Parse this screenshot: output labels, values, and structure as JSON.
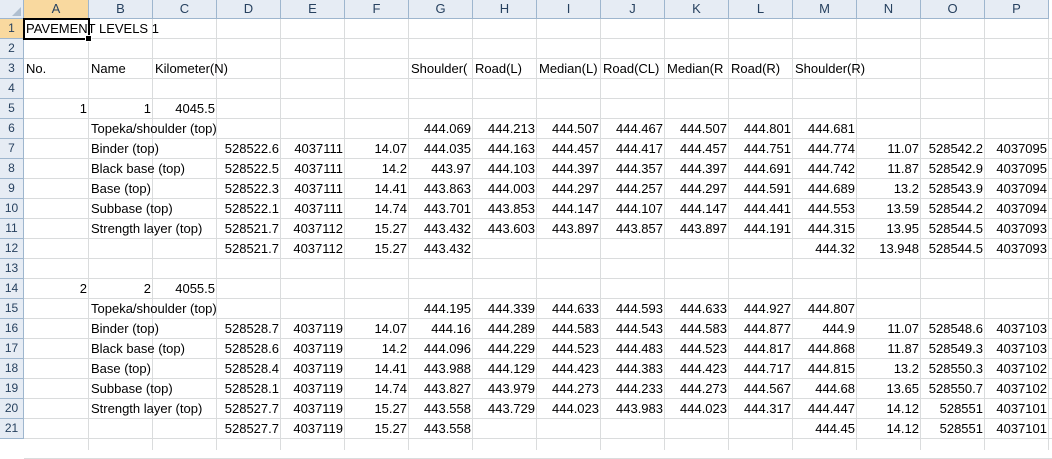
{
  "columns": [
    "A",
    "B",
    "C",
    "D",
    "E",
    "F",
    "G",
    "H",
    "I",
    "J",
    "K",
    "L",
    "M",
    "N",
    "O",
    "P"
  ],
  "rows": [
    "1",
    "2",
    "3",
    "4",
    "5",
    "6",
    "7",
    "8",
    "9",
    "10",
    "11",
    "12",
    "13",
    "14",
    "15",
    "16",
    "17",
    "18",
    "19",
    "20",
    "21"
  ],
  "active_cell": "A1",
  "cells": [
    {
      "r": 0,
      "c": 0,
      "v": "PAVEMENT LEVELS 1",
      "t": "s"
    },
    {
      "r": 2,
      "c": 0,
      "v": "No.",
      "t": "s"
    },
    {
      "r": 2,
      "c": 1,
      "v": "Name",
      "t": "s"
    },
    {
      "r": 2,
      "c": 2,
      "v": "Kilometer(N)",
      "t": "s"
    },
    {
      "r": 2,
      "c": 6,
      "v": "Shoulder(",
      "t": "s"
    },
    {
      "r": 2,
      "c": 7,
      "v": "Road(L)",
      "t": "s"
    },
    {
      "r": 2,
      "c": 8,
      "v": "Median(L)",
      "t": "s"
    },
    {
      "r": 2,
      "c": 9,
      "v": "Road(CL)",
      "t": "s"
    },
    {
      "r": 2,
      "c": 10,
      "v": "Median(R",
      "t": "s"
    },
    {
      "r": 2,
      "c": 11,
      "v": "Road(R)",
      "t": "s"
    },
    {
      "r": 2,
      "c": 12,
      "v": "Shoulder(R)",
      "t": "s"
    },
    {
      "r": 4,
      "c": 0,
      "v": "1",
      "t": "n"
    },
    {
      "r": 4,
      "c": 1,
      "v": "1",
      "t": "n"
    },
    {
      "r": 4,
      "c": 2,
      "v": "4045.5",
      "t": "n"
    },
    {
      "r": 5,
      "c": 1,
      "v": "Topeka/shoulder (top)",
      "t": "s"
    },
    {
      "r": 5,
      "c": 6,
      "v": "444.069",
      "t": "n"
    },
    {
      "r": 5,
      "c": 7,
      "v": "444.213",
      "t": "n"
    },
    {
      "r": 5,
      "c": 8,
      "v": "444.507",
      "t": "n"
    },
    {
      "r": 5,
      "c": 9,
      "v": "444.467",
      "t": "n"
    },
    {
      "r": 5,
      "c": 10,
      "v": "444.507",
      "t": "n"
    },
    {
      "r": 5,
      "c": 11,
      "v": "444.801",
      "t": "n"
    },
    {
      "r": 5,
      "c": 12,
      "v": "444.681",
      "t": "n"
    },
    {
      "r": 6,
      "c": 1,
      "v": "Binder (top)",
      "t": "s"
    },
    {
      "r": 6,
      "c": 3,
      "v": "528522.6",
      "t": "n"
    },
    {
      "r": 6,
      "c": 4,
      "v": "4037111",
      "t": "n"
    },
    {
      "r": 6,
      "c": 5,
      "v": "14.07",
      "t": "n"
    },
    {
      "r": 6,
      "c": 6,
      "v": "444.035",
      "t": "n"
    },
    {
      "r": 6,
      "c": 7,
      "v": "444.163",
      "t": "n"
    },
    {
      "r": 6,
      "c": 8,
      "v": "444.457",
      "t": "n"
    },
    {
      "r": 6,
      "c": 9,
      "v": "444.417",
      "t": "n"
    },
    {
      "r": 6,
      "c": 10,
      "v": "444.457",
      "t": "n"
    },
    {
      "r": 6,
      "c": 11,
      "v": "444.751",
      "t": "n"
    },
    {
      "r": 6,
      "c": 12,
      "v": "444.774",
      "t": "n"
    },
    {
      "r": 6,
      "c": 13,
      "v": "11.07",
      "t": "n"
    },
    {
      "r": 6,
      "c": 14,
      "v": "528542.2",
      "t": "n"
    },
    {
      "r": 6,
      "c": 15,
      "v": "4037095",
      "t": "n"
    },
    {
      "r": 7,
      "c": 1,
      "v": "Black base (top)",
      "t": "s"
    },
    {
      "r": 7,
      "c": 3,
      "v": "528522.5",
      "t": "n"
    },
    {
      "r": 7,
      "c": 4,
      "v": "4037111",
      "t": "n"
    },
    {
      "r": 7,
      "c": 5,
      "v": "14.2",
      "t": "n"
    },
    {
      "r": 7,
      "c": 6,
      "v": "443.97",
      "t": "n"
    },
    {
      "r": 7,
      "c": 7,
      "v": "444.103",
      "t": "n"
    },
    {
      "r": 7,
      "c": 8,
      "v": "444.397",
      "t": "n"
    },
    {
      "r": 7,
      "c": 9,
      "v": "444.357",
      "t": "n"
    },
    {
      "r": 7,
      "c": 10,
      "v": "444.397",
      "t": "n"
    },
    {
      "r": 7,
      "c": 11,
      "v": "444.691",
      "t": "n"
    },
    {
      "r": 7,
      "c": 12,
      "v": "444.742",
      "t": "n"
    },
    {
      "r": 7,
      "c": 13,
      "v": "11.87",
      "t": "n"
    },
    {
      "r": 7,
      "c": 14,
      "v": "528542.9",
      "t": "n"
    },
    {
      "r": 7,
      "c": 15,
      "v": "4037095",
      "t": "n"
    },
    {
      "r": 8,
      "c": 1,
      "v": "Base (top)",
      "t": "s"
    },
    {
      "r": 8,
      "c": 3,
      "v": "528522.3",
      "t": "n"
    },
    {
      "r": 8,
      "c": 4,
      "v": "4037111",
      "t": "n"
    },
    {
      "r": 8,
      "c": 5,
      "v": "14.41",
      "t": "n"
    },
    {
      "r": 8,
      "c": 6,
      "v": "443.863",
      "t": "n"
    },
    {
      "r": 8,
      "c": 7,
      "v": "444.003",
      "t": "n"
    },
    {
      "r": 8,
      "c": 8,
      "v": "444.297",
      "t": "n"
    },
    {
      "r": 8,
      "c": 9,
      "v": "444.257",
      "t": "n"
    },
    {
      "r": 8,
      "c": 10,
      "v": "444.297",
      "t": "n"
    },
    {
      "r": 8,
      "c": 11,
      "v": "444.591",
      "t": "n"
    },
    {
      "r": 8,
      "c": 12,
      "v": "444.689",
      "t": "n"
    },
    {
      "r": 8,
      "c": 13,
      "v": "13.2",
      "t": "n"
    },
    {
      "r": 8,
      "c": 14,
      "v": "528543.9",
      "t": "n"
    },
    {
      "r": 8,
      "c": 15,
      "v": "4037094",
      "t": "n"
    },
    {
      "r": 9,
      "c": 1,
      "v": "Subbase (top)",
      "t": "s"
    },
    {
      "r": 9,
      "c": 3,
      "v": "528522.1",
      "t": "n"
    },
    {
      "r": 9,
      "c": 4,
      "v": "4037111",
      "t": "n"
    },
    {
      "r": 9,
      "c": 5,
      "v": "14.74",
      "t": "n"
    },
    {
      "r": 9,
      "c": 6,
      "v": "443.701",
      "t": "n"
    },
    {
      "r": 9,
      "c": 7,
      "v": "443.853",
      "t": "n"
    },
    {
      "r": 9,
      "c": 8,
      "v": "444.147",
      "t": "n"
    },
    {
      "r": 9,
      "c": 9,
      "v": "444.107",
      "t": "n"
    },
    {
      "r": 9,
      "c": 10,
      "v": "444.147",
      "t": "n"
    },
    {
      "r": 9,
      "c": 11,
      "v": "444.441",
      "t": "n"
    },
    {
      "r": 9,
      "c": 12,
      "v": "444.553",
      "t": "n"
    },
    {
      "r": 9,
      "c": 13,
      "v": "13.59",
      "t": "n"
    },
    {
      "r": 9,
      "c": 14,
      "v": "528544.2",
      "t": "n"
    },
    {
      "r": 9,
      "c": 15,
      "v": "4037094",
      "t": "n"
    },
    {
      "r": 10,
      "c": 1,
      "v": "Strength layer (top)",
      "t": "s"
    },
    {
      "r": 10,
      "c": 3,
      "v": "528521.7",
      "t": "n"
    },
    {
      "r": 10,
      "c": 4,
      "v": "4037112",
      "t": "n"
    },
    {
      "r": 10,
      "c": 5,
      "v": "15.27",
      "t": "n"
    },
    {
      "r": 10,
      "c": 6,
      "v": "443.432",
      "t": "n"
    },
    {
      "r": 10,
      "c": 7,
      "v": "443.603",
      "t": "n"
    },
    {
      "r": 10,
      "c": 8,
      "v": "443.897",
      "t": "n"
    },
    {
      "r": 10,
      "c": 9,
      "v": "443.857",
      "t": "n"
    },
    {
      "r": 10,
      "c": 10,
      "v": "443.897",
      "t": "n"
    },
    {
      "r": 10,
      "c": 11,
      "v": "444.191",
      "t": "n"
    },
    {
      "r": 10,
      "c": 12,
      "v": "444.315",
      "t": "n"
    },
    {
      "r": 10,
      "c": 13,
      "v": "13.95",
      "t": "n"
    },
    {
      "r": 10,
      "c": 14,
      "v": "528544.5",
      "t": "n"
    },
    {
      "r": 10,
      "c": 15,
      "v": "4037093",
      "t": "n"
    },
    {
      "r": 11,
      "c": 3,
      "v": "528521.7",
      "t": "n"
    },
    {
      "r": 11,
      "c": 4,
      "v": "4037112",
      "t": "n"
    },
    {
      "r": 11,
      "c": 5,
      "v": "15.27",
      "t": "n"
    },
    {
      "r": 11,
      "c": 6,
      "v": "443.432",
      "t": "n"
    },
    {
      "r": 11,
      "c": 12,
      "v": "444.32",
      "t": "n"
    },
    {
      "r": 11,
      "c": 13,
      "v": "13.948",
      "t": "n"
    },
    {
      "r": 11,
      "c": 14,
      "v": "528544.5",
      "t": "n"
    },
    {
      "r": 11,
      "c": 15,
      "v": "4037093",
      "t": "n"
    },
    {
      "r": 13,
      "c": 0,
      "v": "2",
      "t": "n"
    },
    {
      "r": 13,
      "c": 1,
      "v": "2",
      "t": "n"
    },
    {
      "r": 13,
      "c": 2,
      "v": "4055.5",
      "t": "n"
    },
    {
      "r": 14,
      "c": 1,
      "v": "Topeka/shoulder (top)",
      "t": "s"
    },
    {
      "r": 14,
      "c": 6,
      "v": "444.195",
      "t": "n"
    },
    {
      "r": 14,
      "c": 7,
      "v": "444.339",
      "t": "n"
    },
    {
      "r": 14,
      "c": 8,
      "v": "444.633",
      "t": "n"
    },
    {
      "r": 14,
      "c": 9,
      "v": "444.593",
      "t": "n"
    },
    {
      "r": 14,
      "c": 10,
      "v": "444.633",
      "t": "n"
    },
    {
      "r": 14,
      "c": 11,
      "v": "444.927",
      "t": "n"
    },
    {
      "r": 14,
      "c": 12,
      "v": "444.807",
      "t": "n"
    },
    {
      "r": 15,
      "c": 1,
      "v": "Binder (top)",
      "t": "s"
    },
    {
      "r": 15,
      "c": 3,
      "v": "528528.7",
      "t": "n"
    },
    {
      "r": 15,
      "c": 4,
      "v": "4037119",
      "t": "n"
    },
    {
      "r": 15,
      "c": 5,
      "v": "14.07",
      "t": "n"
    },
    {
      "r": 15,
      "c": 6,
      "v": "444.16",
      "t": "n"
    },
    {
      "r": 15,
      "c": 7,
      "v": "444.289",
      "t": "n"
    },
    {
      "r": 15,
      "c": 8,
      "v": "444.583",
      "t": "n"
    },
    {
      "r": 15,
      "c": 9,
      "v": "444.543",
      "t": "n"
    },
    {
      "r": 15,
      "c": 10,
      "v": "444.583",
      "t": "n"
    },
    {
      "r": 15,
      "c": 11,
      "v": "444.877",
      "t": "n"
    },
    {
      "r": 15,
      "c": 12,
      "v": "444.9",
      "t": "n"
    },
    {
      "r": 15,
      "c": 13,
      "v": "11.07",
      "t": "n"
    },
    {
      "r": 15,
      "c": 14,
      "v": "528548.6",
      "t": "n"
    },
    {
      "r": 15,
      "c": 15,
      "v": "4037103",
      "t": "n"
    },
    {
      "r": 16,
      "c": 1,
      "v": "Black base (top)",
      "t": "s"
    },
    {
      "r": 16,
      "c": 3,
      "v": "528528.6",
      "t": "n"
    },
    {
      "r": 16,
      "c": 4,
      "v": "4037119",
      "t": "n"
    },
    {
      "r": 16,
      "c": 5,
      "v": "14.2",
      "t": "n"
    },
    {
      "r": 16,
      "c": 6,
      "v": "444.096",
      "t": "n"
    },
    {
      "r": 16,
      "c": 7,
      "v": "444.229",
      "t": "n"
    },
    {
      "r": 16,
      "c": 8,
      "v": "444.523",
      "t": "n"
    },
    {
      "r": 16,
      "c": 9,
      "v": "444.483",
      "t": "n"
    },
    {
      "r": 16,
      "c": 10,
      "v": "444.523",
      "t": "n"
    },
    {
      "r": 16,
      "c": 11,
      "v": "444.817",
      "t": "n"
    },
    {
      "r": 16,
      "c": 12,
      "v": "444.868",
      "t": "n"
    },
    {
      "r": 16,
      "c": 13,
      "v": "11.87",
      "t": "n"
    },
    {
      "r": 16,
      "c": 14,
      "v": "528549.3",
      "t": "n"
    },
    {
      "r": 16,
      "c": 15,
      "v": "4037103",
      "t": "n"
    },
    {
      "r": 17,
      "c": 1,
      "v": "Base (top)",
      "t": "s"
    },
    {
      "r": 17,
      "c": 3,
      "v": "528528.4",
      "t": "n"
    },
    {
      "r": 17,
      "c": 4,
      "v": "4037119",
      "t": "n"
    },
    {
      "r": 17,
      "c": 5,
      "v": "14.41",
      "t": "n"
    },
    {
      "r": 17,
      "c": 6,
      "v": "443.988",
      "t": "n"
    },
    {
      "r": 17,
      "c": 7,
      "v": "444.129",
      "t": "n"
    },
    {
      "r": 17,
      "c": 8,
      "v": "444.423",
      "t": "n"
    },
    {
      "r": 17,
      "c": 9,
      "v": "444.383",
      "t": "n"
    },
    {
      "r": 17,
      "c": 10,
      "v": "444.423",
      "t": "n"
    },
    {
      "r": 17,
      "c": 11,
      "v": "444.717",
      "t": "n"
    },
    {
      "r": 17,
      "c": 12,
      "v": "444.815",
      "t": "n"
    },
    {
      "r": 17,
      "c": 13,
      "v": "13.2",
      "t": "n"
    },
    {
      "r": 17,
      "c": 14,
      "v": "528550.3",
      "t": "n"
    },
    {
      "r": 17,
      "c": 15,
      "v": "4037102",
      "t": "n"
    },
    {
      "r": 18,
      "c": 1,
      "v": "Subbase (top)",
      "t": "s"
    },
    {
      "r": 18,
      "c": 3,
      "v": "528528.1",
      "t": "n"
    },
    {
      "r": 18,
      "c": 4,
      "v": "4037119",
      "t": "n"
    },
    {
      "r": 18,
      "c": 5,
      "v": "14.74",
      "t": "n"
    },
    {
      "r": 18,
      "c": 6,
      "v": "443.827",
      "t": "n"
    },
    {
      "r": 18,
      "c": 7,
      "v": "443.979",
      "t": "n"
    },
    {
      "r": 18,
      "c": 8,
      "v": "444.273",
      "t": "n"
    },
    {
      "r": 18,
      "c": 9,
      "v": "444.233",
      "t": "n"
    },
    {
      "r": 18,
      "c": 10,
      "v": "444.273",
      "t": "n"
    },
    {
      "r": 18,
      "c": 11,
      "v": "444.567",
      "t": "n"
    },
    {
      "r": 18,
      "c": 12,
      "v": "444.68",
      "t": "n"
    },
    {
      "r": 18,
      "c": 13,
      "v": "13.65",
      "t": "n"
    },
    {
      "r": 18,
      "c": 14,
      "v": "528550.7",
      "t": "n"
    },
    {
      "r": 18,
      "c": 15,
      "v": "4037102",
      "t": "n"
    },
    {
      "r": 19,
      "c": 1,
      "v": "Strength layer (top)",
      "t": "s"
    },
    {
      "r": 19,
      "c": 3,
      "v": "528527.7",
      "t": "n"
    },
    {
      "r": 19,
      "c": 4,
      "v": "4037119",
      "t": "n"
    },
    {
      "r": 19,
      "c": 5,
      "v": "15.27",
      "t": "n"
    },
    {
      "r": 19,
      "c": 6,
      "v": "443.558",
      "t": "n"
    },
    {
      "r": 19,
      "c": 7,
      "v": "443.729",
      "t": "n"
    },
    {
      "r": 19,
      "c": 8,
      "v": "444.023",
      "t": "n"
    },
    {
      "r": 19,
      "c": 9,
      "v": "443.983",
      "t": "n"
    },
    {
      "r": 19,
      "c": 10,
      "v": "444.023",
      "t": "n"
    },
    {
      "r": 19,
      "c": 11,
      "v": "444.317",
      "t": "n"
    },
    {
      "r": 19,
      "c": 12,
      "v": "444.447",
      "t": "n"
    },
    {
      "r": 19,
      "c": 13,
      "v": "14.12",
      "t": "n"
    },
    {
      "r": 19,
      "c": 14,
      "v": "528551",
      "t": "n"
    },
    {
      "r": 19,
      "c": 15,
      "v": "4037101",
      "t": "n"
    },
    {
      "r": 20,
      "c": 3,
      "v": "528527.7",
      "t": "n"
    },
    {
      "r": 20,
      "c": 4,
      "v": "4037119",
      "t": "n"
    },
    {
      "r": 20,
      "c": 5,
      "v": "15.27",
      "t": "n"
    },
    {
      "r": 20,
      "c": 6,
      "v": "443.558",
      "t": "n"
    },
    {
      "r": 20,
      "c": 12,
      "v": "444.45",
      "t": "n"
    },
    {
      "r": 20,
      "c": 13,
      "v": "14.12",
      "t": "n"
    },
    {
      "r": 20,
      "c": 14,
      "v": "528551",
      "t": "n"
    },
    {
      "r": 20,
      "c": 15,
      "v": "4037101",
      "t": "n"
    }
  ]
}
